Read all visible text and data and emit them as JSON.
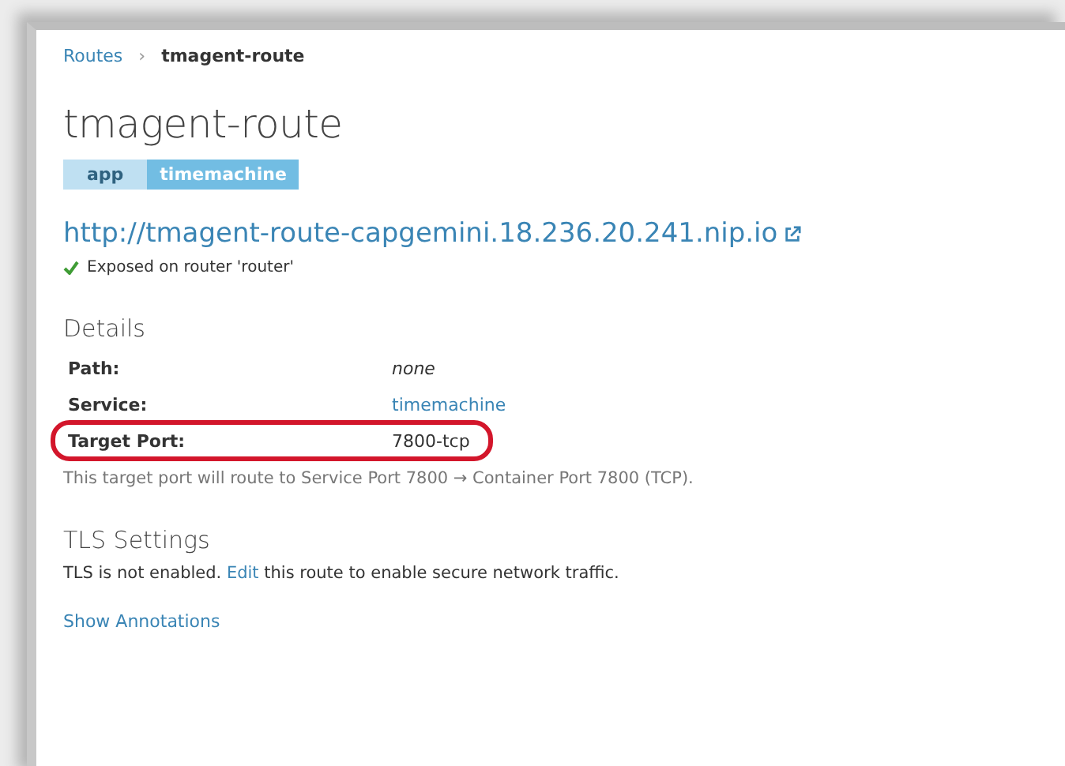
{
  "breadcrumb": {
    "items": [
      "Routes"
    ],
    "separator": "›",
    "current": "tmagent-route"
  },
  "title": "tmagent-route",
  "labels": [
    {
      "key": "app",
      "value": "timemachine"
    }
  ],
  "route_url": "http://tmagent-route-capgemini.18.236.20.241.nip.io",
  "exposed": "Exposed on router 'router'",
  "details": {
    "heading": "Details",
    "rows": [
      {
        "label": "Path:",
        "value": "none",
        "kind": "empty",
        "highlighted": false
      },
      {
        "label": "Service:",
        "value": "timemachine",
        "kind": "link",
        "highlighted": false
      },
      {
        "label": "Target Port:",
        "value": "7800-tcp",
        "kind": "text",
        "highlighted": true
      }
    ],
    "note": "This target port will route to Service Port 7800 → Container Port 7800 (TCP)."
  },
  "tls": {
    "heading": "TLS Settings",
    "before": "TLS is not enabled. ",
    "link": "Edit",
    "after": " this route to enable secure network traffic."
  },
  "show_annotations": "Show Annotations"
}
